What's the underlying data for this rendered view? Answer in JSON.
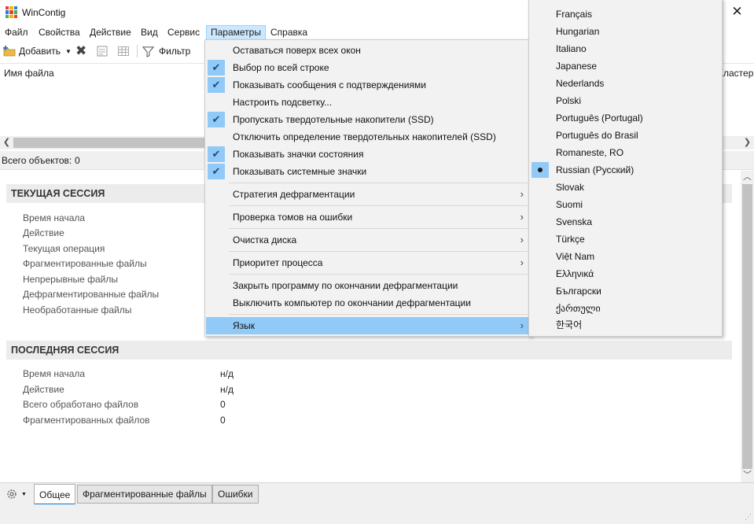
{
  "window": {
    "title": "WinContig",
    "close_glyph": "✕"
  },
  "menubar": [
    "Файл",
    "Свойства",
    "Действие",
    "Вид",
    "Сервис",
    "Параметры",
    "Справка"
  ],
  "toolbar": {
    "add_label": "Добавить",
    "filter_label": "Фильтр"
  },
  "list": {
    "columns": [
      "Имя файла",
      "Кластер"
    ],
    "status_label": "Всего объектов:",
    "status_value": "0"
  },
  "current_session": {
    "title": "ТЕКУЩАЯ СЕССИЯ",
    "rows": [
      "Время начала",
      "Действие",
      "Текущая операция",
      "Фрагментированные файлы",
      "Непрерывные файлы",
      "Дефрагментированные файлы",
      "Необработанные файлы"
    ]
  },
  "last_session": {
    "title": "ПОСЛЕДНЯЯ СЕССИЯ",
    "rows": [
      {
        "label": "Время начала",
        "value": "н/д"
      },
      {
        "label": "Действие",
        "value": "н/д"
      },
      {
        "label": "Всего обработано файлов",
        "value": "0"
      },
      {
        "label": "Фрагментированных файлов",
        "value": "0"
      }
    ]
  },
  "bottom_tabs": [
    "Общее",
    "Фрагментированные файлы",
    "Ошибки"
  ],
  "params_menu": [
    {
      "label": "Оставаться поверх всех окон",
      "checked": false
    },
    {
      "label": "Выбор по всей строке",
      "checked": true
    },
    {
      "label": "Показывать сообщения с подтверждениями",
      "checked": true
    },
    {
      "label": "Настроить подсветку...",
      "checked": false
    },
    {
      "label": "Пропускать твердотельные накопители (SSD)",
      "checked": true
    },
    {
      "label": "Отключить определение твердотельных накопителей (SSD)",
      "checked": false
    },
    {
      "label": "Показывать значки состояния",
      "checked": true
    },
    {
      "label": "Показывать системные значки",
      "checked": true
    },
    {
      "label": "Стратегия дефрагментации",
      "submenu": true
    },
    {
      "label": "Проверка томов на ошибки",
      "submenu": true
    },
    {
      "label": "Очистка диска",
      "submenu": true
    },
    {
      "label": "Приоритет процесса",
      "submenu": true
    },
    {
      "label": "Закрыть программу по окончании дефрагментации",
      "checked": false
    },
    {
      "label": "Выключить компьютер по окончании дефрагментации",
      "checked": false
    },
    {
      "label": "Язык",
      "submenu": true,
      "highlighted": true
    }
  ],
  "languages": {
    "items": [
      "Français",
      "Hungarian",
      "Italiano",
      "Japanese",
      "Nederlands",
      "Polski",
      "Português (Portugal)",
      "Português do Brasil",
      "Romaneste, RO",
      "Russian (Русский)",
      "Slovak",
      "Suomi",
      "Svenska",
      "Türkçe",
      "Việt Nam",
      "Ελληνικά",
      "Български",
      "ქართული",
      "한국어"
    ],
    "selected": "Russian (Русский)"
  },
  "colors": {
    "highlight": "#91c9f7",
    "menu_active": "#cce8ff",
    "tab_accent": "#0078d7"
  }
}
